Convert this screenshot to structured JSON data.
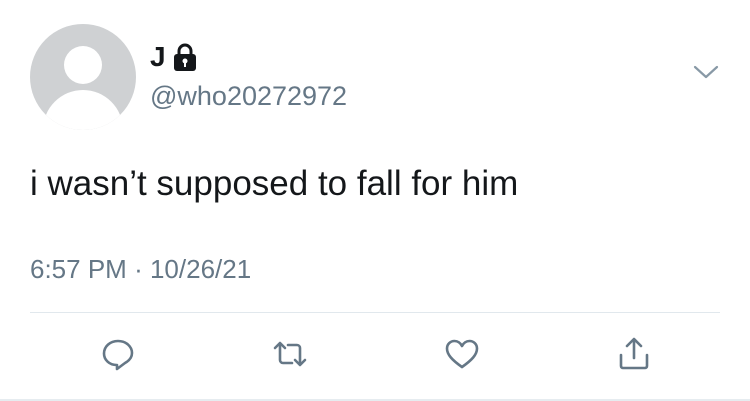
{
  "user": {
    "display_name": "J",
    "handle": "@who20272972",
    "avatar_icon": "default-avatar-icon",
    "protected_icon": "lock-icon"
  },
  "tweet": {
    "text": "i wasn’t supposed to fall for him",
    "time": "6:57 PM",
    "separator": "·",
    "date": "10/26/21"
  },
  "actions": [
    {
      "name": "reply",
      "icon": "reply-icon"
    },
    {
      "name": "retweet",
      "icon": "retweet-icon"
    },
    {
      "name": "like",
      "icon": "heart-icon"
    },
    {
      "name": "share",
      "icon": "share-icon"
    }
  ],
  "colors": {
    "text_primary": "#14171a",
    "text_secondary": "#657786",
    "avatar_bg": "#cfd1d3",
    "divider": "#e1e8ed"
  }
}
